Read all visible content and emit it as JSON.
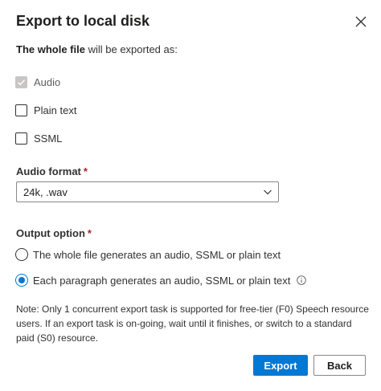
{
  "dialog": {
    "title": "Export to local disk",
    "subtitle_bold": "The whole file",
    "subtitle_rest": " will be exported as:",
    "close_icon": "close-icon"
  },
  "formats": [
    {
      "label": "Audio",
      "checked": true,
      "disabled": true
    },
    {
      "label": "Plain text",
      "checked": false,
      "disabled": false
    },
    {
      "label": "SSML",
      "checked": false,
      "disabled": false
    }
  ],
  "audio_format": {
    "label": "Audio format",
    "required_mark": "*",
    "value": "24k, .wav"
  },
  "output_option": {
    "label": "Output option",
    "required_mark": "*",
    "options": [
      {
        "label": "The whole file generates an audio, SSML or plain text",
        "selected": false
      },
      {
        "label": "Each paragraph generates an audio, SSML or plain text",
        "selected": true
      }
    ]
  },
  "note": "Note: Only 1 concurrent export task is supported for free-tier (F0) Speech resource users. If an export task is on-going, wait until it finishes, or switch to a standard paid (S0) resource.",
  "buttons": {
    "export": "Export",
    "back": "Back"
  },
  "colors": {
    "accent": "#0078d4",
    "required": "#a4262c",
    "disabled_check": "#c8c6c4"
  }
}
